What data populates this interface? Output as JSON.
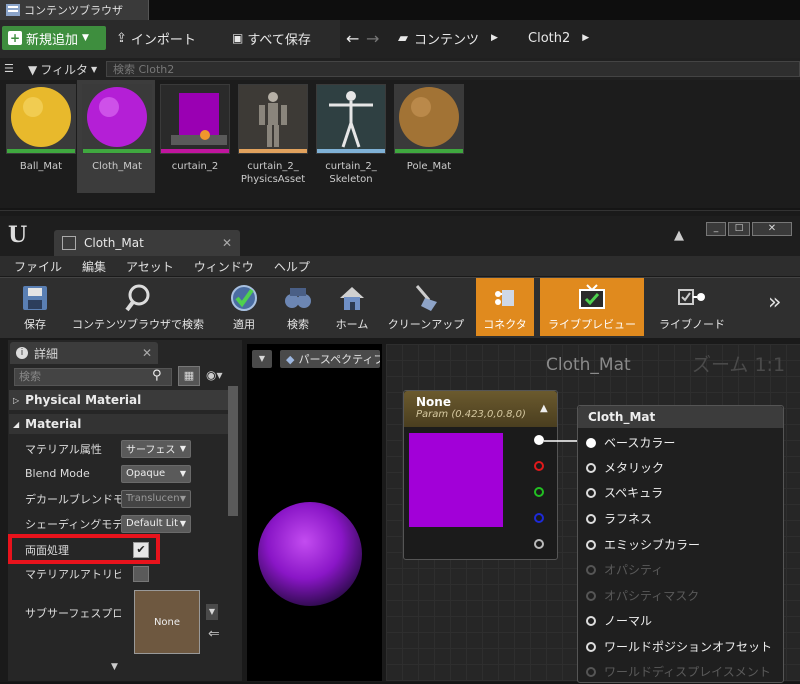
{
  "content_browser": {
    "tab_title": "コンテンツブラウザ",
    "add_new": "新規追加",
    "import": "インポート",
    "save_all": "すべて保存",
    "breadcrumb": [
      "コンテンツ",
      "Cloth2"
    ],
    "filter": "フィルタ",
    "search_placeholder": "検索 Cloth2",
    "assets": [
      {
        "name": "Ball_Mat",
        "color": "#e8b92c",
        "bar": "#3fa83f"
      },
      {
        "name": "Cloth_Mat",
        "color": "#b41fd6",
        "bar": "#3fa83f"
      },
      {
        "name": "curtain_2",
        "color": "#a000b5",
        "bar": "#c0159e"
      },
      {
        "name": "curtain_2_\nPhysicsAsset",
        "color": "#807a70",
        "bar": "#e2a25d"
      },
      {
        "name": "curtain_2_\nSkeleton",
        "color": "#cfd4d4",
        "bar": "#7fb1d6"
      },
      {
        "name": "Pole_Mat",
        "color": "#a27335",
        "bar": "#3fa83f"
      }
    ]
  },
  "editor": {
    "tab_title": "Cloth_Mat",
    "menu": [
      "ファイル",
      "編集",
      "アセット",
      "ウィンドウ",
      "ヘルプ"
    ],
    "toolbar": [
      {
        "label": "保存",
        "icon": "floppy-icon",
        "active": false
      },
      {
        "label": "コンテンツブラウザで検索",
        "icon": "magnifier-icon",
        "active": false
      },
      {
        "label": "適用",
        "icon": "checkmark-icon",
        "active": false
      },
      {
        "label": "検索",
        "icon": "binoculars-icon",
        "active": false
      },
      {
        "label": "ホーム",
        "icon": "home-icon",
        "active": false
      },
      {
        "label": "クリーンアップ",
        "icon": "broom-icon",
        "active": false
      },
      {
        "label": "コネクタ",
        "icon": "connector-icon",
        "active": true
      },
      {
        "label": "ライブプレビュー",
        "icon": "tv-icon",
        "active": true
      },
      {
        "label": "ライブノード",
        "icon": "livenode-icon",
        "active": false
      }
    ],
    "more": "»"
  },
  "details": {
    "tab_title": "詳細",
    "search_placeholder": "検索",
    "categories": [
      "Physical Material",
      "Material"
    ],
    "properties": [
      {
        "label": "マテリアル属性",
        "value": "サーフェス"
      },
      {
        "label": "Blend Mode",
        "value": "Opaque"
      },
      {
        "label": "デカールブレンドモード",
        "value": "Translucent"
      },
      {
        "label": "シェーディングモデル",
        "value": "Default Lit"
      },
      {
        "label": "両面処理",
        "value": ""
      },
      {
        "label": "マテリアルアトリビュート",
        "value": ""
      },
      {
        "label": "サブサーフェスプロファイル",
        "value": "None"
      }
    ],
    "two_sided_checked": true
  },
  "viewport": {
    "view_mode": "パースペクティブ",
    "sphere_color": "#9a1fd4"
  },
  "graph": {
    "title": "Cloth_Mat",
    "zoom": "ズーム 1:1",
    "param_node": {
      "title": "None",
      "subtitle": "Param (0.423,0,0.8,0)",
      "color": "#a200d8"
    },
    "material_node": {
      "title": "Cloth_Mat",
      "inputs": [
        {
          "label": "ベースカラー",
          "enabled": true
        },
        {
          "label": "メタリック",
          "enabled": true
        },
        {
          "label": "スペキュラ",
          "enabled": true
        },
        {
          "label": "ラフネス",
          "enabled": true
        },
        {
          "label": "エミッシブカラー",
          "enabled": true
        },
        {
          "label": "オパシティ",
          "enabled": false
        },
        {
          "label": "オパシティマスク",
          "enabled": false
        },
        {
          "label": "ノーマル",
          "enabled": true
        },
        {
          "label": "ワールドポジションオフセット",
          "enabled": true
        },
        {
          "label": "ワールドディスプレイスメント",
          "enabled": false
        }
      ]
    }
  }
}
